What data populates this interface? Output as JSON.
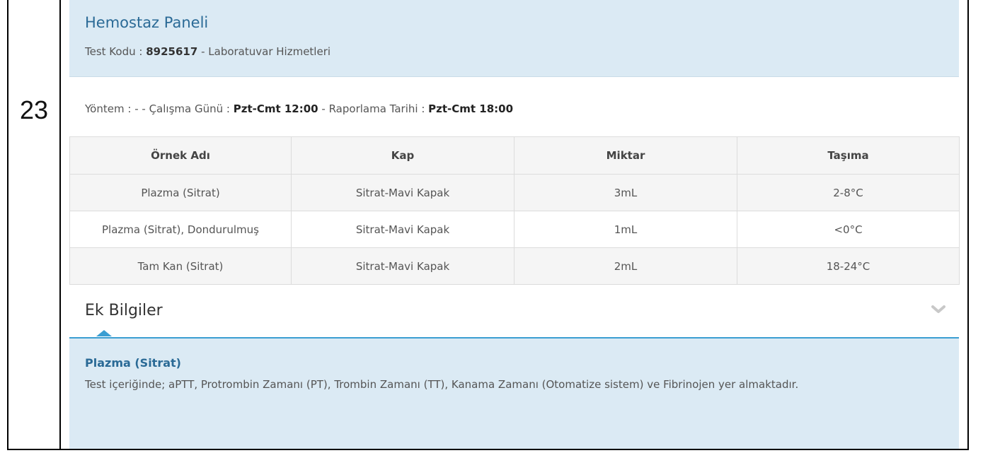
{
  "row_number": "23",
  "test": {
    "name": "Hemostaz Paneli",
    "code_label": "Test Kodu :",
    "code": "8925617",
    "separator": "-",
    "lab": "Laboratuvar Hizmetleri"
  },
  "meta": {
    "method_label": "Yöntem :",
    "method_value": "-",
    "work_day_label": "- Çalışma Günü :",
    "work_day_value": "Pzt-Cmt 12:00",
    "report_label": "- Raporlama Tarihi :",
    "report_value": "Pzt-Cmt 18:00"
  },
  "table": {
    "headers": [
      "Örnek Adı",
      "Kap",
      "Miktar",
      "Taşıma"
    ],
    "rows": [
      [
        "Plazma (Sitrat)",
        "Sitrat-Mavi Kapak",
        "3mL",
        "2-8°C"
      ],
      [
        "Plazma (Sitrat), Dondurulmuş",
        "Sitrat-Mavi Kapak",
        "1mL",
        "<0°C"
      ],
      [
        "Tam Kan (Sitrat)",
        "Sitrat-Mavi Kapak",
        "2mL",
        "18-24°C"
      ]
    ]
  },
  "extra": {
    "title": "Ek Bilgiler",
    "toggle_icon": "chevron-down-icon",
    "sample_title": "Plazma (Sitrat)",
    "text": "Test içeriğinde; aPTT, Protrombin Zamanı (PT), Trombin Zamanı (TT), Kanama Zamanı (Otomatize sistem) ve Fibrinojen yer almaktadır."
  },
  "colors": {
    "accent": "#3b9ed2",
    "title_blue": "#2a6a96",
    "panel_bg": "#dbeaf4"
  }
}
